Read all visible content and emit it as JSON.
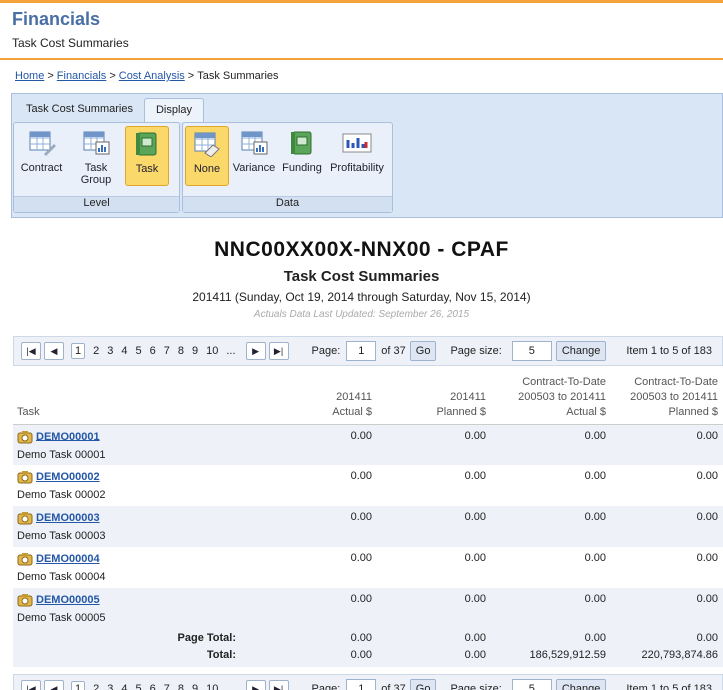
{
  "header": {
    "app": "Financials",
    "sub": "Task Cost Summaries"
  },
  "breadcrumb": {
    "items": [
      "Home",
      "Financials",
      "Cost Analysis"
    ],
    "current": "Task Summaries",
    "sep": ">"
  },
  "ribbon": {
    "tabs": [
      "Task Cost Summaries",
      "Display"
    ],
    "level": {
      "label": "Level",
      "buttons": [
        "Contract",
        "Task Group",
        "Task"
      ]
    },
    "data": {
      "label": "Data",
      "buttons": [
        "None",
        "Variance",
        "Funding",
        "Profitability"
      ]
    }
  },
  "report": {
    "title": "NNC00XX00X-NNX00 - CPAF",
    "subtitle": "Task Cost Summaries",
    "period": "201411 (Sunday, Oct 19, 2014 through Saturday, Nov 15, 2014)",
    "updated": "Actuals Data Last Updated: September 26, 2015"
  },
  "pager": {
    "pages": [
      "1",
      "2",
      "3",
      "4",
      "5",
      "6",
      "7",
      "8",
      "9",
      "10",
      "..."
    ],
    "page_label": "Page:",
    "page_value": "1",
    "of_label": "of 37",
    "go": "Go",
    "size_label": "Page size:",
    "size_value": "5",
    "change": "Change",
    "item_info": "Item 1 to 5 of 183"
  },
  "table": {
    "columns": [
      {
        "l1": "",
        "l2": "",
        "l3": "Task"
      },
      {
        "l1": "",
        "l2": "201411",
        "l3": "Actual $"
      },
      {
        "l1": "",
        "l2": "201411",
        "l3": "Planned $"
      },
      {
        "l1": "Contract-To-Date",
        "l2": "200503 to 201411",
        "l3": "Actual $"
      },
      {
        "l1": "Contract-To-Date",
        "l2": "200503 to 201411",
        "l3": "Planned $"
      }
    ],
    "rows": [
      {
        "code": "DEMO00001",
        "desc": "Demo Task 00001",
        "v": [
          "0.00",
          "0.00",
          "0.00",
          "0.00"
        ]
      },
      {
        "code": "DEMO00002",
        "desc": "Demo Task 00002",
        "v": [
          "0.00",
          "0.00",
          "0.00",
          "0.00"
        ]
      },
      {
        "code": "DEMO00003",
        "desc": "Demo Task 00003",
        "v": [
          "0.00",
          "0.00",
          "0.00",
          "0.00"
        ]
      },
      {
        "code": "DEMO00004",
        "desc": "Demo Task 00004",
        "v": [
          "0.00",
          "0.00",
          "0.00",
          "0.00"
        ]
      },
      {
        "code": "DEMO00005",
        "desc": "Demo Task 00005",
        "v": [
          "0.00",
          "0.00",
          "0.00",
          "0.00"
        ]
      }
    ],
    "page_total": {
      "label": "Page Total:",
      "v": [
        "0.00",
        "0.00",
        "0.00",
        "0.00"
      ]
    },
    "total": {
      "label": "Total:",
      "v": [
        "0.00",
        "0.00",
        "186,529,912.59",
        "220,793,874.86"
      ]
    }
  }
}
